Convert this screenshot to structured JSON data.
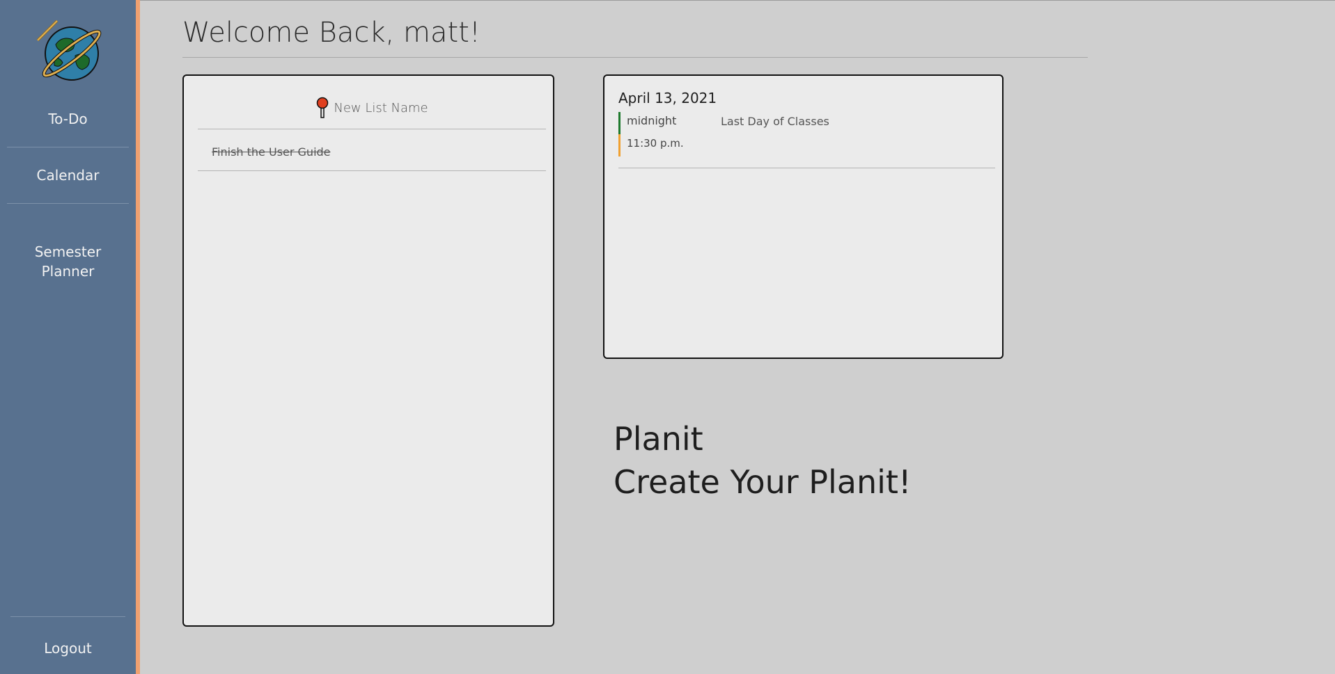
{
  "colors": {
    "sidebar_bg": "#58718f",
    "sidebar_accent": "#f0a070",
    "page_bg": "#cfcfcf",
    "card_bg": "#ebebeb",
    "event_start_marker": "#1f7a2e",
    "event_end_marker": "#f0a030"
  },
  "sidebar": {
    "logo_icon": "planet-pencil-logo",
    "items": [
      {
        "label": "To-Do"
      },
      {
        "label": "Calendar"
      },
      {
        "label": "Semester\nPlanner"
      }
    ],
    "logout_label": "Logout"
  },
  "header": {
    "welcome": "Welcome Back, matt!"
  },
  "todo": {
    "pin_icon": "pushpin-icon",
    "list_name": "New List Name",
    "tasks": [
      {
        "text": "Finish the User Guide",
        "completed": true
      }
    ]
  },
  "calendar": {
    "date": "April 13, 2021",
    "events": [
      {
        "start": "midnight",
        "end": "11:30 p.m.",
        "title": "Last Day of Classes"
      }
    ]
  },
  "brand": {
    "name": "Planit",
    "tagline": "Create Your Planit!"
  }
}
